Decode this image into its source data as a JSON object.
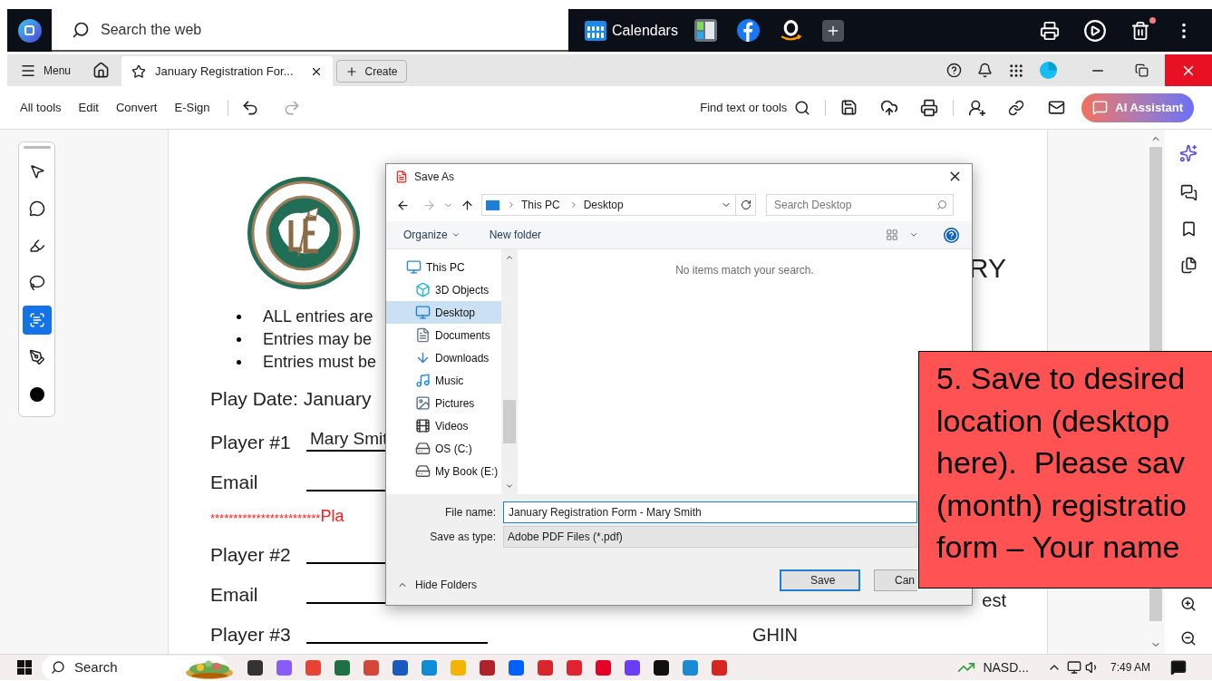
{
  "browser_bar": {
    "search": {
      "placeholder": "Search the web"
    },
    "calendars_label": "Calendars",
    "trash_badge": true
  },
  "tab_bar": {
    "menu_label": "Menu",
    "tabs": [
      {
        "title": "January Registration For...",
        "selected": true
      }
    ],
    "create_label": "Create"
  },
  "toolbar": {
    "menus": [
      {
        "label": "All tools"
      },
      {
        "label": "Edit"
      },
      {
        "label": "Convert"
      },
      {
        "label": "E-Sign"
      }
    ],
    "undo": {
      "disabled": false
    },
    "redo": {
      "disabled": true
    },
    "find_label": "Find text or tools",
    "assistant_label": "AI Assistant"
  },
  "tools": [
    {
      "kind": "pointer",
      "selected": false
    },
    {
      "kind": "comment",
      "selected": false
    },
    {
      "kind": "highlight",
      "selected": false
    },
    {
      "kind": "draw",
      "selected": false
    },
    {
      "kind": "text-select",
      "selected": true
    },
    {
      "kind": "sign",
      "selected": false
    },
    {
      "kind": "color",
      "selected": false
    }
  ],
  "document": {
    "heading_fragment": "RY",
    "bullets": [
      "ALL entries are",
      "Entries may be",
      "Entries must be"
    ],
    "play_date": "Play Date: January",
    "rows": [
      {
        "kind": "field",
        "label": "Player #1",
        "value": "Mary Smit"
      },
      {
        "kind": "field",
        "label": "Email"
      },
      {
        "kind": "notice",
        "asterisks": "************************",
        "text": "Pla"
      },
      {
        "kind": "field",
        "label": "Player #2"
      },
      {
        "kind": "field",
        "label": "Email",
        "trailing": "est"
      },
      {
        "kind": "field",
        "label": "Player #3",
        "second_label": "GHIN"
      }
    ]
  },
  "dialog": {
    "title": "Save As",
    "path": [
      "This PC",
      "Desktop"
    ],
    "search": {
      "placeholder": "Search Desktop"
    },
    "organize_label": "Organize",
    "new_folder_label": "New folder",
    "nav": [
      {
        "label": "This PC",
        "kind": "pc",
        "selected": false,
        "children": [
          {
            "label": "3D Objects",
            "kind": "cube",
            "selected": false
          },
          {
            "label": "Desktop",
            "kind": "desktop",
            "selected": true
          },
          {
            "label": "Documents",
            "kind": "documents",
            "selected": false
          },
          {
            "label": "Downloads",
            "kind": "downloads",
            "selected": false
          },
          {
            "label": "Music",
            "kind": "music",
            "selected": false
          },
          {
            "label": "Pictures",
            "kind": "pictures",
            "selected": false
          },
          {
            "label": "Videos",
            "kind": "videos",
            "selected": false
          },
          {
            "label": "OS (C:)",
            "kind": "drive",
            "selected": false
          },
          {
            "label": "My Book (E:)",
            "kind": "external",
            "selected": false
          }
        ]
      }
    ],
    "empty_message": "No items match your search.",
    "file_name": {
      "label": "File name:",
      "value": "January Registration Form - Mary Smith"
    },
    "file_type": {
      "label": "Save as type:",
      "value": "Adobe PDF Files (*.pdf)"
    },
    "hide_folders_label": "Hide Folders",
    "buttons": [
      {
        "label": "Save",
        "kind": "primary"
      },
      {
        "label": "Can",
        "kind": "secondary"
      }
    ]
  },
  "callout": {
    "lines": [
      "5. Save to desired",
      "location (desktop",
      "here).  Please sav",
      "(month) registratio",
      "form – Your name"
    ]
  },
  "taskbar": {
    "search_label": "Search",
    "stock_label": "NASD...",
    "time": "7:49 AM"
  }
}
